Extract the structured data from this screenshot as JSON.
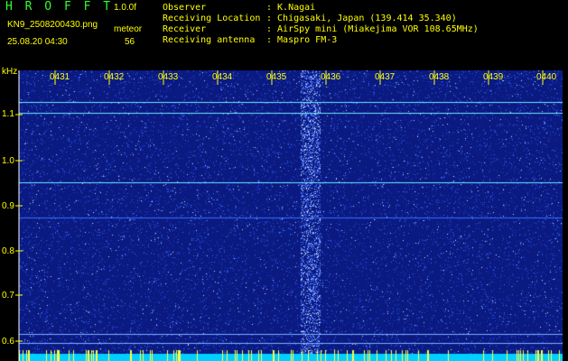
{
  "app": {
    "brand": "H R O F F T",
    "version": "1.0.0f",
    "filename": "KN9_2508200430.png",
    "meteor_label": "meteor",
    "datetime": "25.08.20 04:30",
    "meteor_count": "56"
  },
  "info": [
    {
      "label": "Observer",
      "value": ": K.Nagai"
    },
    {
      "label": "Receiving Location",
      "value": ": Chigasaki, Japan (139.414 35.340)"
    },
    {
      "label": "Receiver",
      "value": ": AirSpy mini (Miakejima VOR 108.65MHz)"
    },
    {
      "label": "Receiving antenna",
      "value": ": Maspro FM-3"
    }
  ],
  "spectrogram": {
    "unit_label": "kHz",
    "time_labels": [
      "0431",
      "0432",
      "0433",
      "0434",
      "0435",
      "0436",
      "0437",
      "0438",
      "0439",
      "0440"
    ],
    "freq_labels": [
      "1.1",
      "1.0",
      "0.9",
      "0.8",
      "0.7",
      "0.6"
    ],
    "colors": {
      "background": "#0a1a80",
      "noise": "#2a5cff",
      "carrier": "#6fe8ff",
      "text": "#ffff00",
      "brand": "#30ff30",
      "baseline": "#00d0ff"
    }
  }
}
